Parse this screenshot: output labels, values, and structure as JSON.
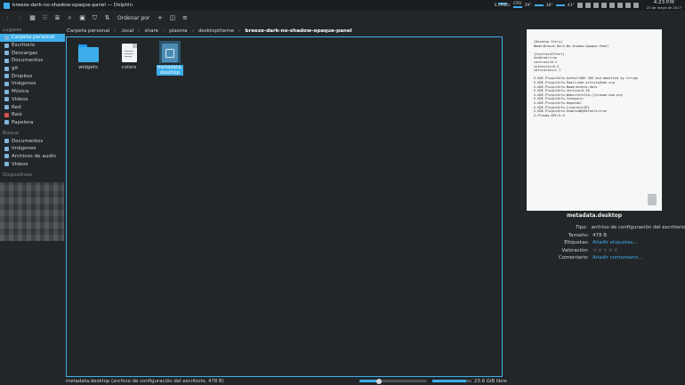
{
  "window": {
    "title": "breeze-dark-no-shadow-opaque-panel — Dolphin"
  },
  "tray": {
    "net_label": "0.0MB/s",
    "cpu_label": "CPU",
    "temp1": "39°",
    "temp2": "38°",
    "temp3": "43°",
    "time": "4:23 P.M",
    "date": "23 de mayo de 2017"
  },
  "toolbar": {
    "sort_label": "Ordenar por"
  },
  "sidebar": {
    "places_title": "Lugares",
    "places": [
      {
        "label": "Carpeta personal",
        "selected": true
      },
      {
        "label": "Escritorio"
      },
      {
        "label": "Descargas"
      },
      {
        "label": "Documentos"
      },
      {
        "label": "git"
      },
      {
        "label": "Dropbox"
      },
      {
        "label": "Imágenes"
      },
      {
        "label": "Música"
      },
      {
        "label": "Videos"
      },
      {
        "label": "Red"
      },
      {
        "label": "Raíz"
      },
      {
        "label": "Papelera"
      }
    ],
    "search_title": "Buscar",
    "search": [
      {
        "label": "Documentos"
      },
      {
        "label": "Imágenes"
      },
      {
        "label": "Archivos de audio"
      },
      {
        "label": "Videos"
      }
    ],
    "devices_title": "Dispositivos"
  },
  "breadcrumb": {
    "items": [
      "Carpeta personal",
      ".local",
      "share",
      "plasma",
      "desktoptheme"
    ],
    "current": "breeze-dark-no-shadow-opaque-panel"
  },
  "files": [
    {
      "name": "widgets",
      "type": "folder"
    },
    {
      "name": "colors",
      "type": "text"
    },
    {
      "name_line1": "metadata.",
      "name_line2": "desktop",
      "type": "desktop",
      "selected": true
    }
  ],
  "status": {
    "message": "metadata.desktop (archivo de configuración del escritorio, 478 B)",
    "free_space": "23.6 GiB libre"
  },
  "info_panel": {
    "preview_lines": [
      "[Desktop Entry]",
      "Name=Breeze-Dark-No-Shadow-Opaque-Panel",
      "",
      "[ContrastEffect]",
      "enabled=true",
      "contrast=0.2",
      "intensity=0.4",
      "saturation=1.7",
      "",
      "X-KDE-PluginInfo-Author=KDE VDG and modified by tctrgk",
      "X-KDE-PluginInfo-Email=kde-artists@kde.org",
      "X-KDE-PluginInfo-Name=breeze-dark",
      "X-KDE-PluginInfo-Version=5.36",
      "X-KDE-PluginInfo-Website=http://plasma.kde.org",
      "X-KDE-PluginInfo-Category=",
      "X-KDE-PluginInfo-Depends=",
      "X-KDE-PluginInfo-License=LGPL",
      "X-KDE-PluginInfo-EnabledByDefault=true",
      "X-Plasma-API=5.0"
    ],
    "filename": "metadata.desktop",
    "type_key": "Tipo:",
    "type_value": "archivo de configuración del escritorio",
    "size_key": "Tamaño:",
    "size_value": "478 B",
    "tags_key": "Etiquetas:",
    "tags_value": "Añadir etiquetas...",
    "rating_key": "Valoración:",
    "rating_value": "☆☆☆☆☆",
    "comment_key": "Comentario:",
    "comment_value": "Añadir comentario..."
  },
  "colors": {
    "accent": "#3daee9",
    "background": "#232629"
  }
}
